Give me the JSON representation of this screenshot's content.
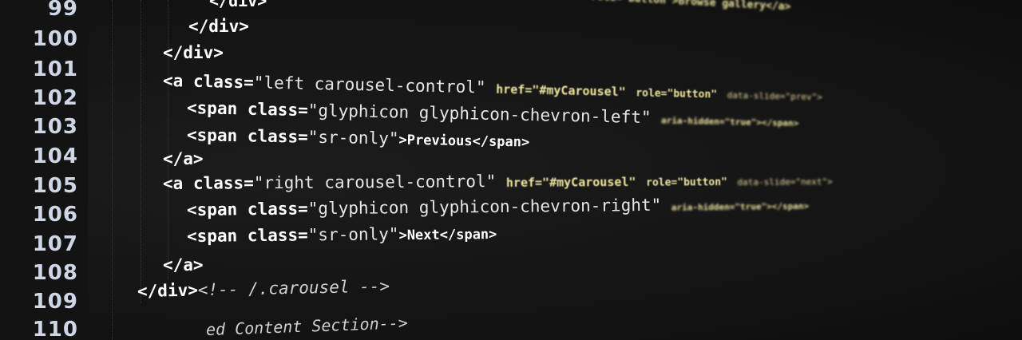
{
  "gutter": {
    "line_numbers": [
      "99",
      "100",
      "101",
      "102",
      "103",
      "104",
      "105",
      "106",
      "107",
      "108",
      "109",
      "110"
    ]
  },
  "lines": {
    "l99": {
      "a": "</div>",
      "b": "role=\"button\">Browse gallery</a>"
    },
    "l100": {
      "a": "</div>"
    },
    "l101": {
      "a": "</div>"
    },
    "l102": {
      "open": "<a",
      "attr": "class=",
      "val": "\"left carousel-control\"",
      "href": "href=\"#myCarousel\"",
      "role": "role=\"button\"",
      "slide": "data-slide=\"prev\">"
    },
    "l103": {
      "open": "<span",
      "attr": "class=",
      "val": "\"glyphicon glyphicon-chevron-left\"",
      "aria": "aria-hidden=\"true\"></span>"
    },
    "l104": {
      "open": "<span",
      "attr": "class=",
      "val": "\"sr-only\"",
      "close": ">Previous</span>"
    },
    "l105": {
      "a": "</a>"
    },
    "l106": {
      "open": "<a",
      "attr": "class=",
      "val": "\"right carousel-control\"",
      "href": "href=\"#myCarousel\"",
      "role": "role=\"button\"",
      "slide": "data-slide=\"next\">"
    },
    "l107": {
      "open": "<span",
      "attr": "class=",
      "val": "\"glyphicon glyphicon-chevron-right\"",
      "aria": "aria-hidden=\"true\"></span>"
    },
    "l108": {
      "open": "<span",
      "attr": "class=",
      "val": "\"sr-only\"",
      "close": ">Next</span>"
    },
    "l109": {
      "a": "</a>"
    },
    "l110": {
      "a": "</div>",
      "comment": "<!-- /.carousel -->"
    },
    "l111": {
      "comment": "ed Content Section-->"
    }
  }
}
